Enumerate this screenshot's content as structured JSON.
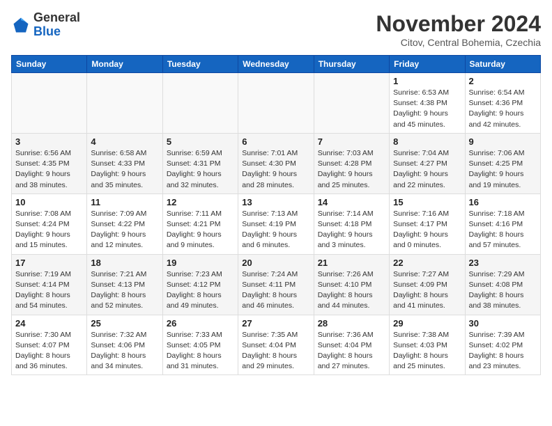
{
  "header": {
    "logo_line1": "General",
    "logo_line2": "Blue",
    "month_title": "November 2024",
    "subtitle": "Citov, Central Bohemia, Czechia"
  },
  "weekdays": [
    "Sunday",
    "Monday",
    "Tuesday",
    "Wednesday",
    "Thursday",
    "Friday",
    "Saturday"
  ],
  "weeks": [
    [
      {
        "day": "",
        "info": ""
      },
      {
        "day": "",
        "info": ""
      },
      {
        "day": "",
        "info": ""
      },
      {
        "day": "",
        "info": ""
      },
      {
        "day": "",
        "info": ""
      },
      {
        "day": "1",
        "info": "Sunrise: 6:53 AM\nSunset: 4:38 PM\nDaylight: 9 hours and 45 minutes."
      },
      {
        "day": "2",
        "info": "Sunrise: 6:54 AM\nSunset: 4:36 PM\nDaylight: 9 hours and 42 minutes."
      }
    ],
    [
      {
        "day": "3",
        "info": "Sunrise: 6:56 AM\nSunset: 4:35 PM\nDaylight: 9 hours and 38 minutes."
      },
      {
        "day": "4",
        "info": "Sunrise: 6:58 AM\nSunset: 4:33 PM\nDaylight: 9 hours and 35 minutes."
      },
      {
        "day": "5",
        "info": "Sunrise: 6:59 AM\nSunset: 4:31 PM\nDaylight: 9 hours and 32 minutes."
      },
      {
        "day": "6",
        "info": "Sunrise: 7:01 AM\nSunset: 4:30 PM\nDaylight: 9 hours and 28 minutes."
      },
      {
        "day": "7",
        "info": "Sunrise: 7:03 AM\nSunset: 4:28 PM\nDaylight: 9 hours and 25 minutes."
      },
      {
        "day": "8",
        "info": "Sunrise: 7:04 AM\nSunset: 4:27 PM\nDaylight: 9 hours and 22 minutes."
      },
      {
        "day": "9",
        "info": "Sunrise: 7:06 AM\nSunset: 4:25 PM\nDaylight: 9 hours and 19 minutes."
      }
    ],
    [
      {
        "day": "10",
        "info": "Sunrise: 7:08 AM\nSunset: 4:24 PM\nDaylight: 9 hours and 15 minutes."
      },
      {
        "day": "11",
        "info": "Sunrise: 7:09 AM\nSunset: 4:22 PM\nDaylight: 9 hours and 12 minutes."
      },
      {
        "day": "12",
        "info": "Sunrise: 7:11 AM\nSunset: 4:21 PM\nDaylight: 9 hours and 9 minutes."
      },
      {
        "day": "13",
        "info": "Sunrise: 7:13 AM\nSunset: 4:19 PM\nDaylight: 9 hours and 6 minutes."
      },
      {
        "day": "14",
        "info": "Sunrise: 7:14 AM\nSunset: 4:18 PM\nDaylight: 9 hours and 3 minutes."
      },
      {
        "day": "15",
        "info": "Sunrise: 7:16 AM\nSunset: 4:17 PM\nDaylight: 9 hours and 0 minutes."
      },
      {
        "day": "16",
        "info": "Sunrise: 7:18 AM\nSunset: 4:16 PM\nDaylight: 8 hours and 57 minutes."
      }
    ],
    [
      {
        "day": "17",
        "info": "Sunrise: 7:19 AM\nSunset: 4:14 PM\nDaylight: 8 hours and 54 minutes."
      },
      {
        "day": "18",
        "info": "Sunrise: 7:21 AM\nSunset: 4:13 PM\nDaylight: 8 hours and 52 minutes."
      },
      {
        "day": "19",
        "info": "Sunrise: 7:23 AM\nSunset: 4:12 PM\nDaylight: 8 hours and 49 minutes."
      },
      {
        "day": "20",
        "info": "Sunrise: 7:24 AM\nSunset: 4:11 PM\nDaylight: 8 hours and 46 minutes."
      },
      {
        "day": "21",
        "info": "Sunrise: 7:26 AM\nSunset: 4:10 PM\nDaylight: 8 hours and 44 minutes."
      },
      {
        "day": "22",
        "info": "Sunrise: 7:27 AM\nSunset: 4:09 PM\nDaylight: 8 hours and 41 minutes."
      },
      {
        "day": "23",
        "info": "Sunrise: 7:29 AM\nSunset: 4:08 PM\nDaylight: 8 hours and 38 minutes."
      }
    ],
    [
      {
        "day": "24",
        "info": "Sunrise: 7:30 AM\nSunset: 4:07 PM\nDaylight: 8 hours and 36 minutes."
      },
      {
        "day": "25",
        "info": "Sunrise: 7:32 AM\nSunset: 4:06 PM\nDaylight: 8 hours and 34 minutes."
      },
      {
        "day": "26",
        "info": "Sunrise: 7:33 AM\nSunset: 4:05 PM\nDaylight: 8 hours and 31 minutes."
      },
      {
        "day": "27",
        "info": "Sunrise: 7:35 AM\nSunset: 4:04 PM\nDaylight: 8 hours and 29 minutes."
      },
      {
        "day": "28",
        "info": "Sunrise: 7:36 AM\nSunset: 4:04 PM\nDaylight: 8 hours and 27 minutes."
      },
      {
        "day": "29",
        "info": "Sunrise: 7:38 AM\nSunset: 4:03 PM\nDaylight: 8 hours and 25 minutes."
      },
      {
        "day": "30",
        "info": "Sunrise: 7:39 AM\nSunset: 4:02 PM\nDaylight: 8 hours and 23 minutes."
      }
    ]
  ]
}
